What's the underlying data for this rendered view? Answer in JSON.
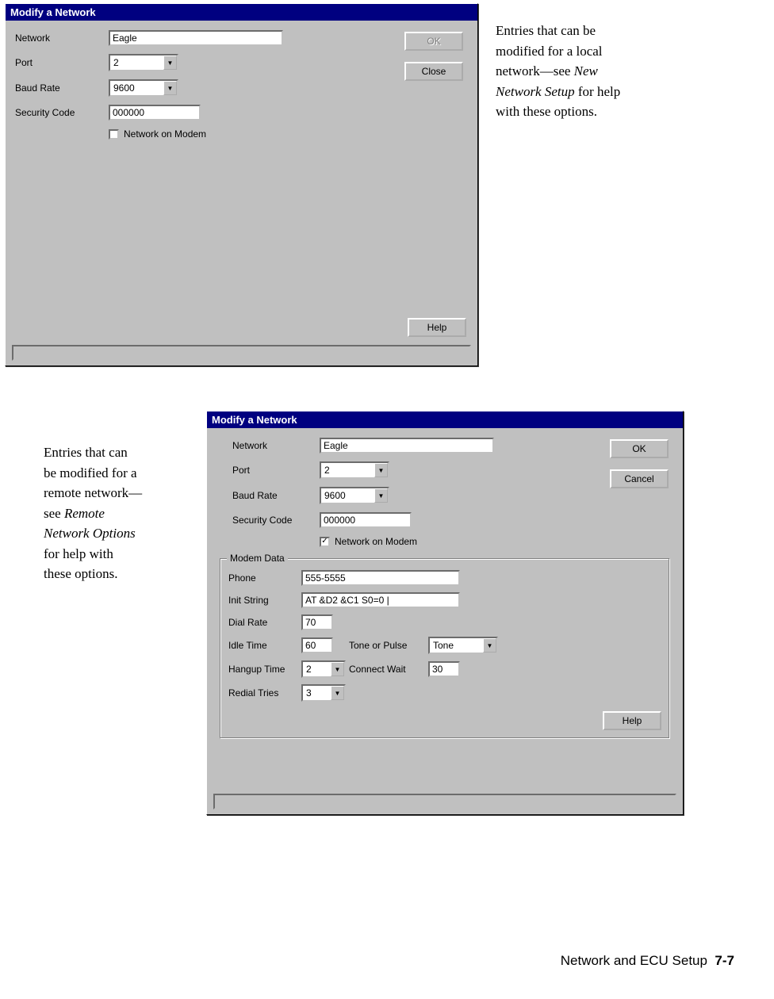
{
  "dialog1": {
    "title": "Modify a Network",
    "labels": {
      "network": "Network",
      "port": "Port",
      "baud": "Baud Rate",
      "security": "Security Code",
      "checkbox": "Network on Modem"
    },
    "values": {
      "network": "Eagle",
      "port": "2",
      "baud": "9600",
      "security": "000000"
    },
    "buttons": {
      "ok": "OK",
      "close": "Close",
      "help": "Help"
    }
  },
  "caption1": {
    "line1": "Entries that can be",
    "line2": "modified for a local",
    "line3a": "network—see ",
    "line3b": "New",
    "line4a": "Network Setup",
    "line4b": " for help",
    "line5": "with these options."
  },
  "caption2": {
    "line1": "Entries that can",
    "line2": "be modified for a",
    "line3": "remote network—",
    "line4a": "see ",
    "line4b": "Remote",
    "line5": "Network Options",
    "line6": "for help with",
    "line7": "these options."
  },
  "dialog2": {
    "title": "Modify a Network",
    "labels": {
      "network": "Network",
      "port": "Port",
      "baud": "Baud Rate",
      "security": "Security Code",
      "checkbox": "Network on Modem"
    },
    "values": {
      "network": "Eagle",
      "port": "2",
      "baud": "9600",
      "security": "000000"
    },
    "buttons": {
      "ok": "OK",
      "cancel": "Cancel",
      "help": "Help"
    },
    "modem": {
      "group_title": "Modem Data",
      "labels": {
        "phone": "Phone",
        "init": "Init String",
        "dialrate": "Dial Rate",
        "idle": "Idle Time",
        "hangup": "Hangup Time",
        "redial": "Redial Tries",
        "tonepulse": "Tone or Pulse",
        "connwait": "Connect Wait"
      },
      "values": {
        "phone": "555-5555",
        "init": "AT &D2 &C1 S0=0 |",
        "dialrate": "70",
        "idle": "60",
        "hangup": "2",
        "redial": "3",
        "tonepulse": "Tone",
        "connwait": "30"
      }
    }
  },
  "footer": {
    "text": "Network and ECU Setup",
    "page": "7-7"
  }
}
